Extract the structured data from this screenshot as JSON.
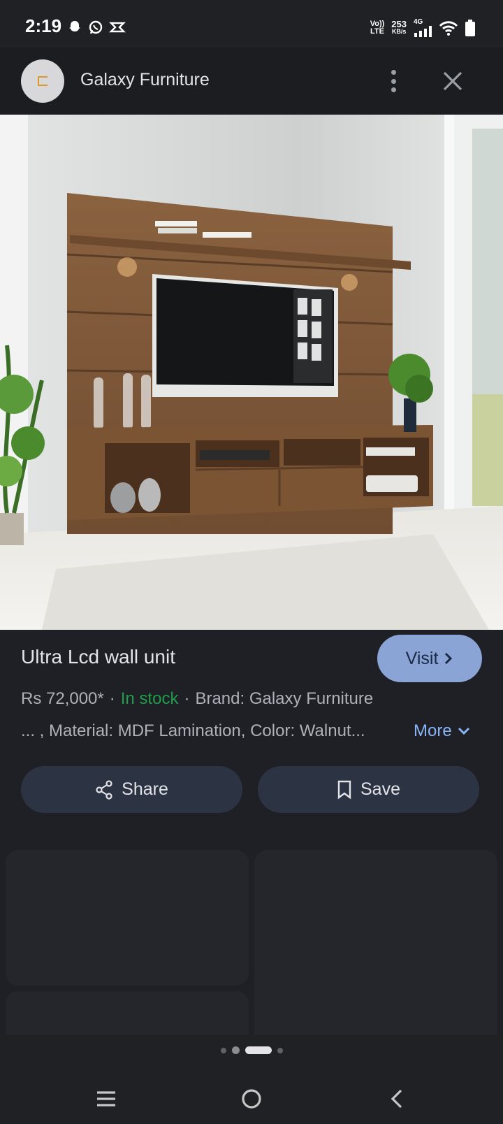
{
  "status": {
    "time": "2:19",
    "network_top": "Vo))",
    "network_bottom": "LTE",
    "speed_value": "253",
    "speed_unit": "KB/s",
    "cell_gen": "4G"
  },
  "header": {
    "site_name": "Galaxy Furniture"
  },
  "product": {
    "title": "Ultra Lcd wall unit",
    "visit_label": "Visit",
    "price": "Rs 72,000*",
    "stock": "In stock",
    "brand": "Brand: Galaxy Furniture",
    "details": "... , Material: MDF Lamination, Color: Walnut...",
    "more_label": "More"
  },
  "actions": {
    "share_label": "Share",
    "save_label": "Save"
  },
  "colors": {
    "background": "#1f2025",
    "accent_button": "#8ba4d6",
    "in_stock": "#1f9d4a",
    "link": "#8ab4f8",
    "action_button": "#2c3342"
  }
}
